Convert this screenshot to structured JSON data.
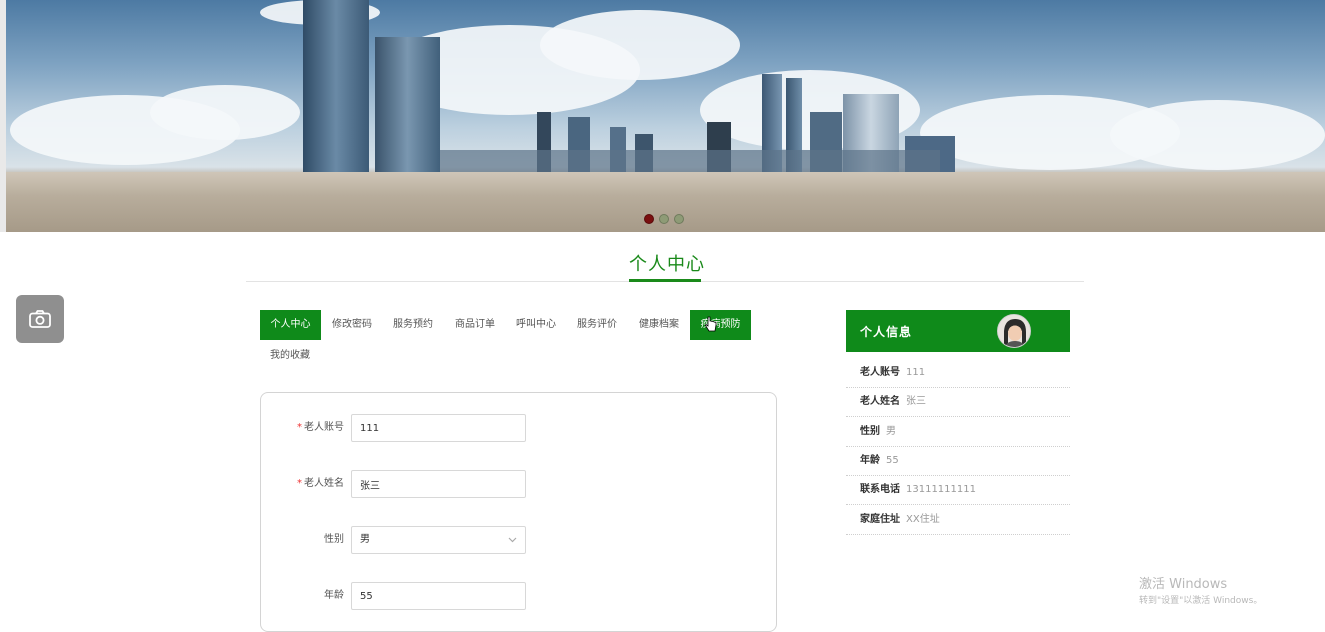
{
  "banner": {
    "slides": 3,
    "active_slide": 1
  },
  "page": {
    "title": "个人中心"
  },
  "tabs": [
    {
      "label": "个人中心",
      "active": true
    },
    {
      "label": "修改密码",
      "active": false
    },
    {
      "label": "服务预约",
      "active": false
    },
    {
      "label": "商品订单",
      "active": false
    },
    {
      "label": "呼叫中心",
      "active": false
    },
    {
      "label": "服务评价",
      "active": false
    },
    {
      "label": "健康档案",
      "active": false
    },
    {
      "label": "疾病预防",
      "active": true
    },
    {
      "label": "我的收藏",
      "active": false
    }
  ],
  "form": {
    "account": {
      "label": "老人账号",
      "value": "111",
      "required": true
    },
    "name": {
      "label": "老人姓名",
      "value": "张三",
      "required": true
    },
    "gender": {
      "label": "性别",
      "value": "男"
    },
    "age": {
      "label": "年龄",
      "value": "55"
    }
  },
  "info": {
    "title": "个人信息",
    "rows": [
      {
        "label": "老人账号",
        "value": "111"
      },
      {
        "label": "老人姓名",
        "value": "张三"
      },
      {
        "label": "性别",
        "value": "男"
      },
      {
        "label": "年龄",
        "value": "55"
      },
      {
        "label": "联系电话",
        "value": "13111111111"
      },
      {
        "label": "家庭住址",
        "value": "XX住址"
      }
    ]
  },
  "watermark": {
    "line1": "激活 Windows",
    "line2": "转到\"设置\"以激活 Windows。"
  },
  "colors": {
    "accent": "#0f8a1a",
    "title_green": "#1a8a1a",
    "required": "#ee3333",
    "active_dot": "#7a0f0f"
  }
}
